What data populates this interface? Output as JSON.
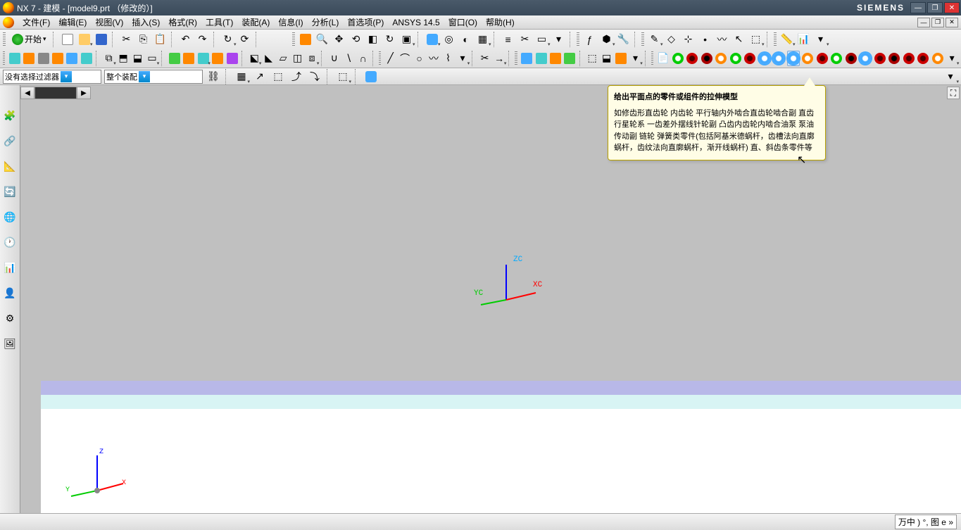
{
  "titlebar": {
    "title": "NX 7 - 建模 - [model9.prt （修改的）]",
    "brand": "SIEMENS"
  },
  "menus": [
    "文件(F)",
    "编辑(E)",
    "视图(V)",
    "插入(S)",
    "格式(R)",
    "工具(T)",
    "装配(A)",
    "信息(I)",
    "分析(L)",
    "首选项(P)",
    "ANSYS 14.5",
    "窗口(O)",
    "帮助(H)"
  ],
  "start_label": "开始",
  "filter": {
    "combo1": "没有选择过滤器",
    "combo2": "整个装配"
  },
  "tooltip": {
    "title": "给出平面点的零件或组件的拉伸模型",
    "body": "如修齿形直齿轮 内齿轮 平行轴内外啮合直齿轮啮合副 直齿行星轮系 一齿差外摆线针轮副 凸齿内齿轮内啮合油泵 泵油传动副 链轮 弹簧类零件(包括阿基米德蜗杆，齿槽法向直廓蜗杆，齿纹法向直廓蜗杆，渐开线蜗杆) 直、斜齿条零件等"
  },
  "triad": {
    "zc": "ZC",
    "yc": "YC",
    "xc": "XC"
  },
  "corner": {
    "z": "Z",
    "x": "X",
    "y": "Y"
  },
  "ime": "万中 ) °,  图 e »"
}
